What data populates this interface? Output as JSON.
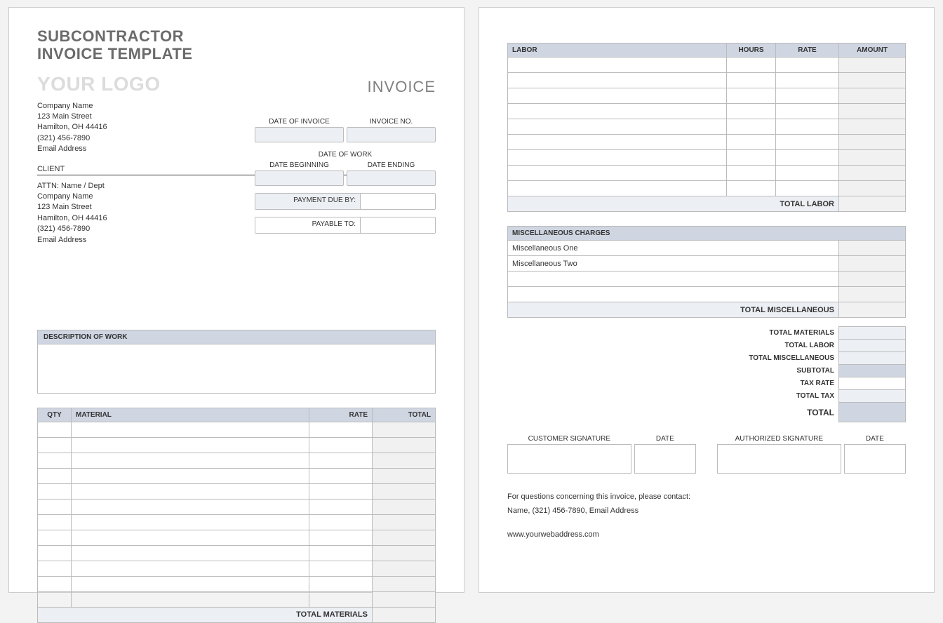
{
  "title_line1": "SUBCONTRACTOR",
  "title_line2": "INVOICE TEMPLATE",
  "logo_text": "YOUR LOGO",
  "invoice_word": "INVOICE",
  "from": {
    "company": "Company Name",
    "street": "123 Main Street",
    "city": "Hamilton, OH  44416",
    "phone": "(321) 456-7890",
    "email": "Email Address"
  },
  "client_header": "CLIENT",
  "client": {
    "attn": "ATTN: Name / Dept",
    "company": "Company Name",
    "street": "123 Main Street",
    "city": "Hamilton, OH  44416",
    "phone": "(321) 456-7890",
    "email": "Email Address"
  },
  "meta": {
    "date_of_invoice_label": "DATE OF INVOICE",
    "invoice_no_label": "INVOICE NO.",
    "date_of_work_label": "DATE OF WORK",
    "date_begin_label": "DATE BEGINNING",
    "date_end_label": "DATE ENDING",
    "payment_due_label": "PAYMENT DUE BY:",
    "payable_to_label": "PAYABLE TO:"
  },
  "sections": {
    "description": "DESCRIPTION OF WORK",
    "materials_cols": {
      "qty": "QTY",
      "material": "MATERIAL",
      "rate": "RATE",
      "total": "TOTAL"
    },
    "total_materials": "TOTAL MATERIALS",
    "labor_cols": {
      "labor": "LABOR",
      "hours": "HOURS",
      "rate": "RATE",
      "amount": "AMOUNT"
    },
    "total_labor": "TOTAL LABOR",
    "misc_header": "MISCELLANEOUS CHARGES",
    "misc_items": [
      "Miscellaneous One",
      "Miscellaneous Two"
    ],
    "total_misc": "TOTAL MISCELLANEOUS"
  },
  "totals": {
    "total_materials": "TOTAL MATERIALS",
    "total_labor": "TOTAL LABOR",
    "total_misc": "TOTAL MISCELLANEOUS",
    "subtotal": "SUBTOTAL",
    "tax_rate": "TAX RATE",
    "total_tax": "TOTAL TAX",
    "total": "TOTAL"
  },
  "signatures": {
    "customer": "CUSTOMER SIGNATURE",
    "authorized": "AUTHORIZED SIGNATURE",
    "date": "DATE"
  },
  "contact": {
    "intro": "For questions concerning this invoice, please contact:",
    "line": "Name, (321) 456-7890, Email Address",
    "web": "www.yourwebaddress.com"
  }
}
